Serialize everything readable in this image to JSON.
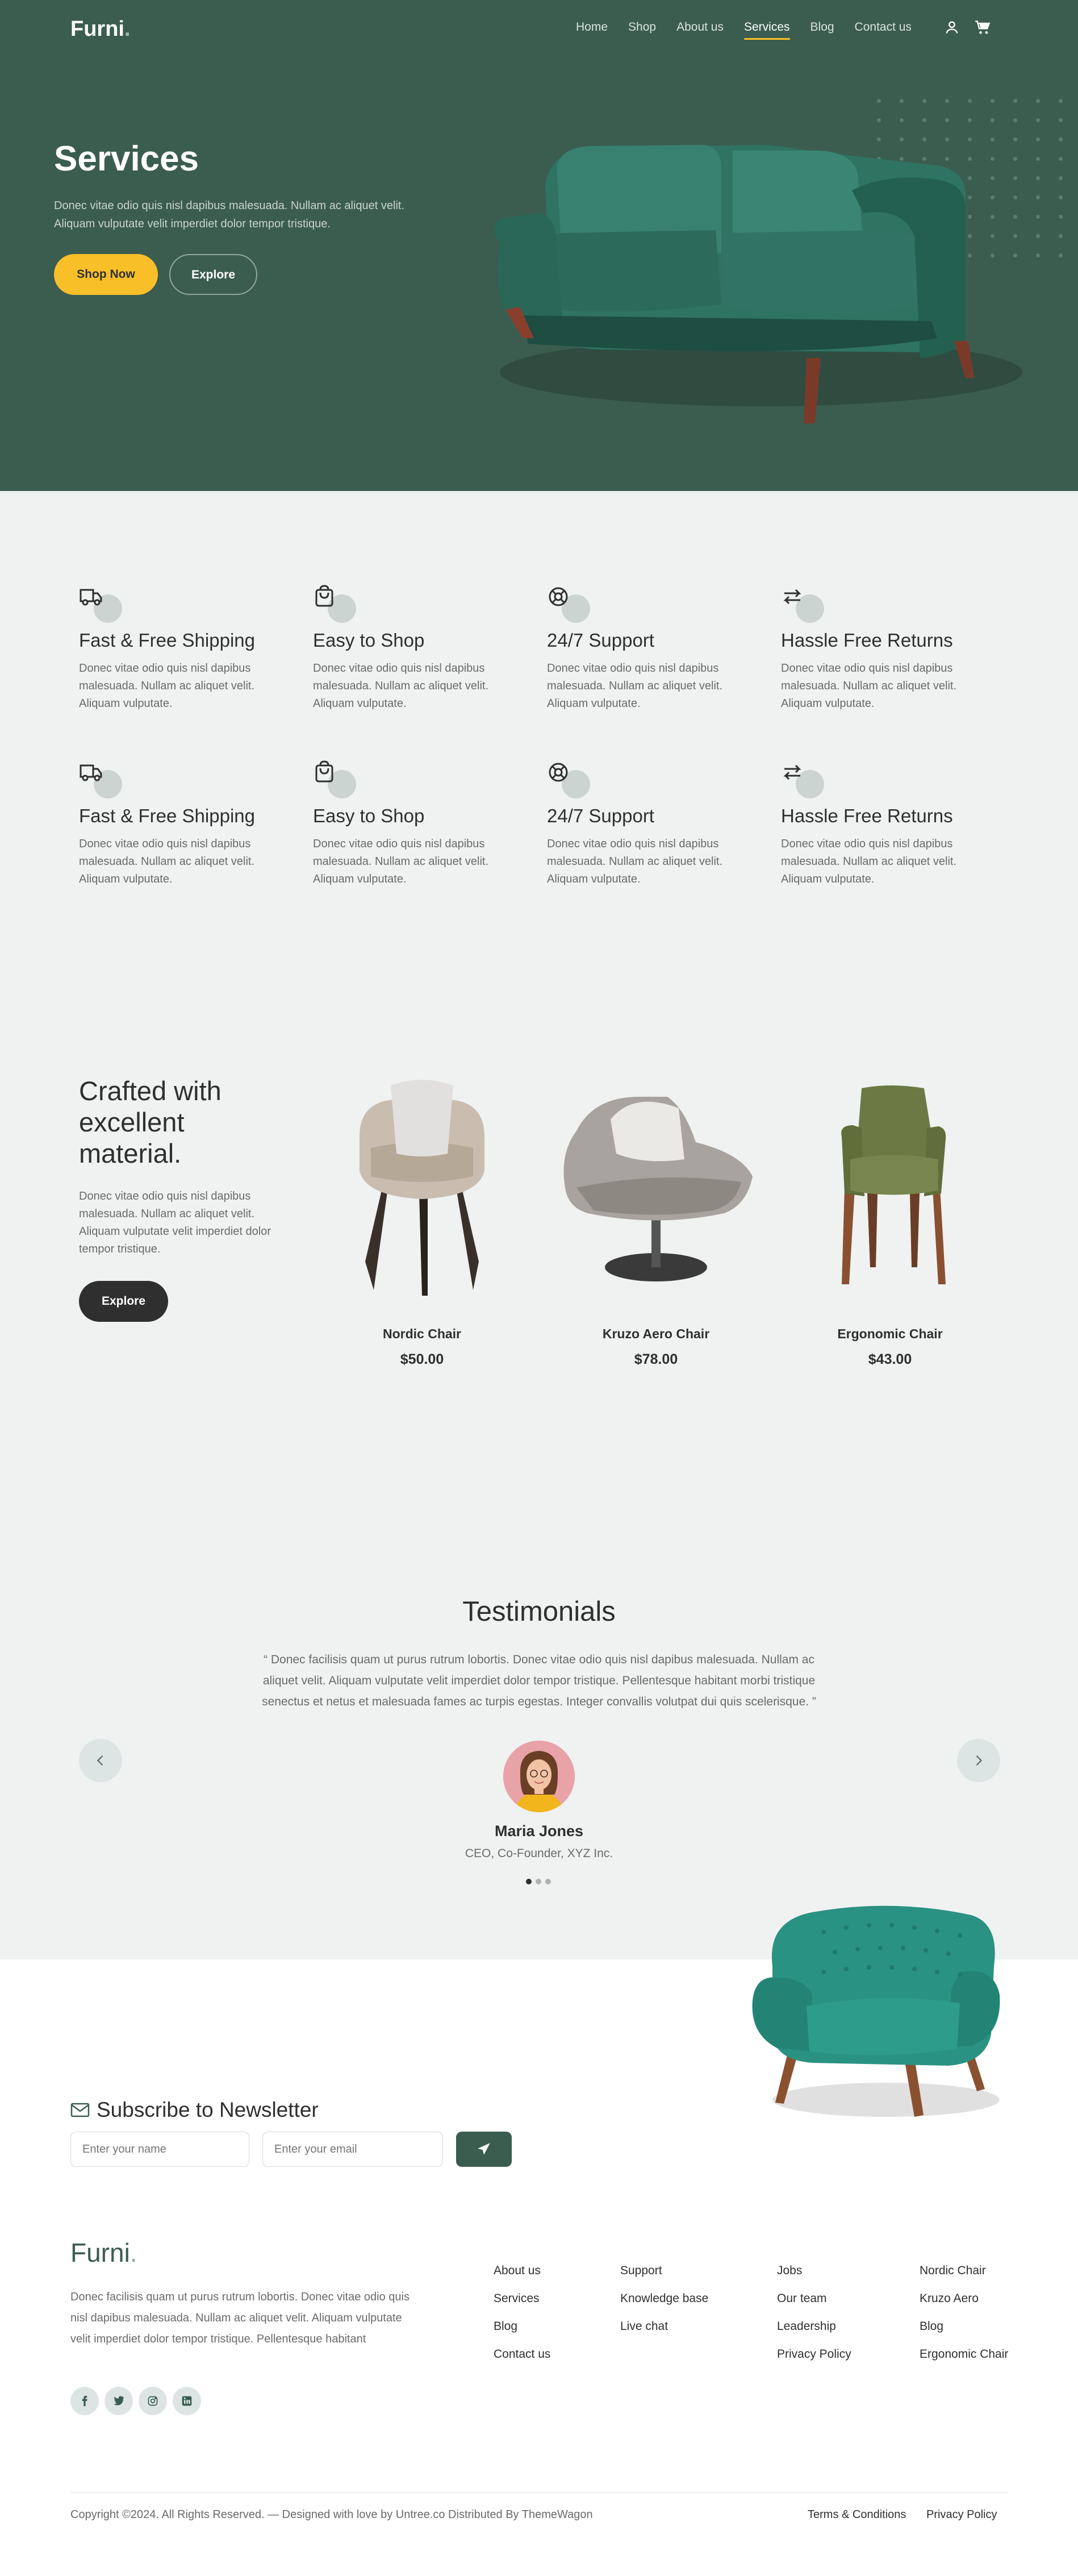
{
  "header": {
    "logo": "Furni",
    "logo_dot": ".",
    "nav": [
      "Home",
      "Shop",
      "About us",
      "Services",
      "Blog",
      "Contact us"
    ],
    "active_nav": "Services",
    "user_icon": "user-icon",
    "cart_icon": "cart-icon"
  },
  "hero": {
    "title": "Services",
    "text": "Donec vitae odio quis nisl dapibus malesuada. Nullam ac aliquet velit. Aliquam vulputate velit imperdiet dolor tempor tristique.",
    "shop_now": "Shop Now",
    "explore": "Explore"
  },
  "features": [
    {
      "icon": "truck-icon",
      "title": "Fast & Free Shipping",
      "text": "Donec vitae odio quis nisl dapibus malesuada. Nullam ac aliquet velit. Aliquam vulputate."
    },
    {
      "icon": "bag-icon",
      "title": "Easy to Shop",
      "text": "Donec vitae odio quis nisl dapibus malesuada. Nullam ac aliquet velit. Aliquam vulputate."
    },
    {
      "icon": "support-icon",
      "title": "24/7 Support",
      "text": "Donec vitae odio quis nisl dapibus malesuada. Nullam ac aliquet velit. Aliquam vulputate."
    },
    {
      "icon": "return-icon",
      "title": "Hassle Free Returns",
      "text": "Donec vitae odio quis nisl dapibus malesuada. Nullam ac aliquet velit. Aliquam vulputate."
    },
    {
      "icon": "truck-icon",
      "title": "Fast & Free Shipping",
      "text": "Donec vitae odio quis nisl dapibus malesuada. Nullam ac aliquet velit. Aliquam vulputate."
    },
    {
      "icon": "bag-icon",
      "title": "Easy to Shop",
      "text": "Donec vitae odio quis nisl dapibus malesuada. Nullam ac aliquet velit. Aliquam vulputate."
    },
    {
      "icon": "support-icon",
      "title": "24/7 Support",
      "text": "Donec vitae odio quis nisl dapibus malesuada. Nullam ac aliquet velit. Aliquam vulputate."
    },
    {
      "icon": "return-icon",
      "title": "Hassle Free Returns",
      "text": "Donec vitae odio quis nisl dapibus malesuada. Nullam ac aliquet velit. Aliquam vulputate."
    }
  ],
  "products_section": {
    "title": "Crafted with excellent material.",
    "text": "Donec vitae odio quis nisl dapibus malesuada. Nullam ac aliquet velit. Aliquam vulputate velit imperdiet dolor tempor tristique.",
    "button": "Explore",
    "products": [
      {
        "name": "Nordic Chair",
        "price": "$50.00"
      },
      {
        "name": "Kruzo Aero Chair",
        "price": "$78.00"
      },
      {
        "name": "Ergonomic Chair",
        "price": "$43.00"
      }
    ]
  },
  "testimonials": {
    "title": "Testimonials",
    "quote": "“ Donec facilisis quam ut purus rutrum lobortis. Donec vitae odio quis nisl dapibus malesuada. Nullam ac aliquet velit. Aliquam vulputate velit imperdiet dolor tempor tristique. Pellentesque habitant morbi tristique senectus et netus et malesuada fames ac turpis egestas. Integer convallis volutpat dui quis scelerisque. ”",
    "name": "Maria Jones",
    "role": "CEO, Co-Founder, XYZ Inc.",
    "prev_icon": "chevron-left-icon",
    "next_icon": "chevron-right-icon"
  },
  "newsletter": {
    "title": "Subscribe to Newsletter",
    "name_placeholder": "Enter your name",
    "email_placeholder": "Enter your email",
    "send_icon": "paper-plane-icon"
  },
  "footer": {
    "logo": "Furni",
    "logo_dot": ".",
    "text": "Donec facilisis quam ut purus rutrum lobortis. Donec vitae odio quis nisl dapibus malesuada. Nullam ac aliquet velit. Aliquam vulputate velit imperdiet dolor tempor tristique. Pellentesque habitant",
    "social": [
      "facebook-icon",
      "twitter-icon",
      "instagram-icon",
      "linkedin-icon"
    ],
    "col1": [
      "About us",
      "Services",
      "Blog",
      "Contact us"
    ],
    "col2": [
      "Support",
      "Knowledge base",
      "Live chat"
    ],
    "col3": [
      "Jobs",
      "Our team",
      "Leadership",
      "Privacy Policy"
    ],
    "col4": [
      "Nordic Chair",
      "Kruzo Aero",
      "Blog",
      "Ergonomic Chair"
    ],
    "copyright": "Copyright ©2024. All Rights Reserved. — Designed with love by Untree.co Distributed By ThemeWagon",
    "terms": "Terms & Conditions",
    "privacy": "Privacy Policy"
  },
  "colors": {
    "primary": "#3b5d50",
    "accent": "#f9bf29",
    "dark": "#2f2f2f",
    "background": "#eff2f1"
  }
}
